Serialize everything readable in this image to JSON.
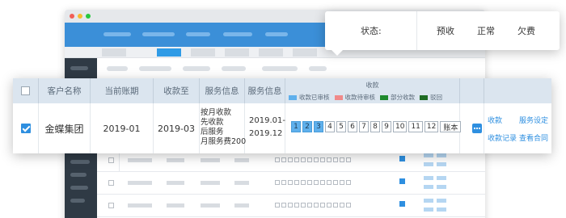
{
  "status_popup": {
    "label": "状态:",
    "options": [
      "预收",
      "正常",
      "欠费"
    ]
  },
  "table": {
    "headers": {
      "customer": "客户名称",
      "current_period": "当前账期",
      "collected_to": "收款至",
      "service_info_1": "服务信息",
      "service_info_2": "服务信息",
      "collection": "收款"
    },
    "legend": [
      {
        "label": "收款已审核",
        "color": "#5fb0ec"
      },
      {
        "label": "收款待审核",
        "color": "#f08a8a"
      },
      {
        "label": "部分收款",
        "color": "#1f8a2e"
      },
      {
        "label": "驳回",
        "color": "#1f6b24"
      }
    ],
    "row": {
      "customer": "金蝶集团",
      "current_period": "2019-01",
      "collected_to": "2019-03",
      "service_lines": [
        "按月收款",
        "先收款",
        "后服务",
        "月服务费200"
      ],
      "period_start": "2019.01-",
      "period_end": "2019.12",
      "months": [
        "1",
        "2",
        "3",
        "4",
        "5",
        "6",
        "7",
        "8",
        "9",
        "10",
        "11",
        "12"
      ],
      "paid_months": 3,
      "account_book": "账本",
      "actions": {
        "collect": "收款",
        "service_settings": "服务设定",
        "collection_records": "收款记录",
        "view_contract": "查看合同"
      }
    }
  },
  "colors": {
    "accent": "#2e8fe0",
    "header_bg": "#dbe5ef",
    "app_topbar": "#3b8fd8",
    "sidebar": "#2f3a45"
  }
}
